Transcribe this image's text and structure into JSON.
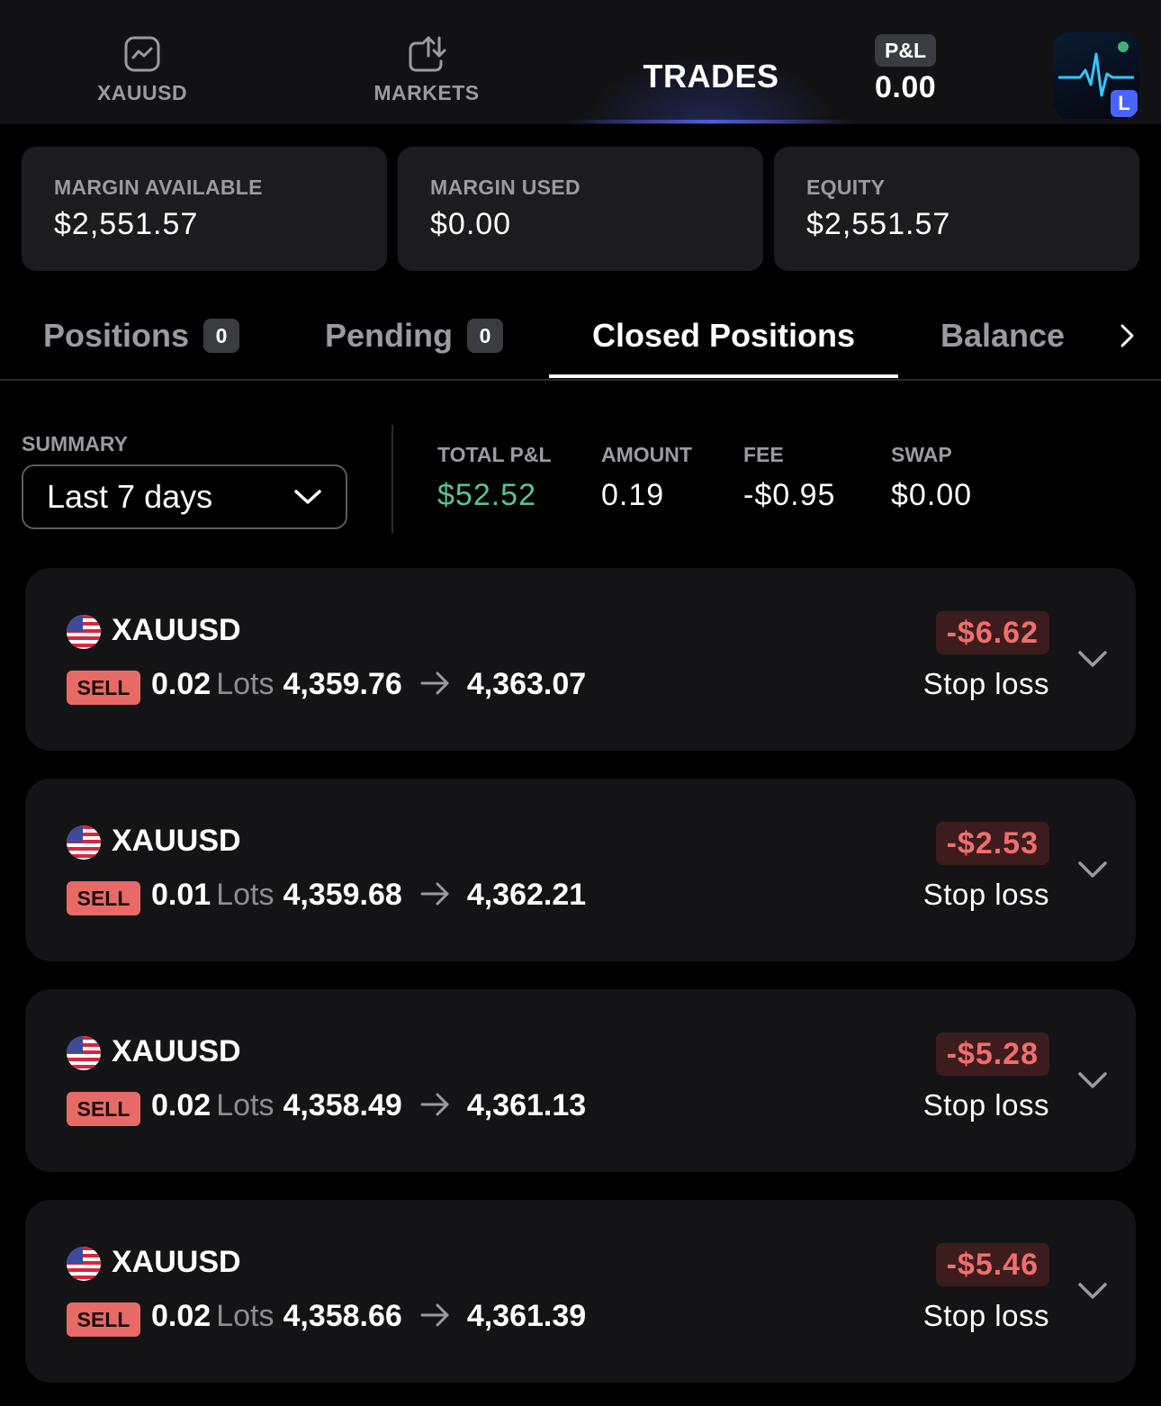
{
  "nav": {
    "xauusd_label": "XAUUSD",
    "markets_label": "MARKETS",
    "trades_label": "TRADES",
    "pnl_badge": "P&L",
    "pnl_value": "0.00",
    "logo_badge": "L"
  },
  "stats": {
    "margin_available": {
      "label": "MARGIN AVAILABLE",
      "value": "$2,551.57"
    },
    "margin_used": {
      "label": "MARGIN USED",
      "value": "$0.00"
    },
    "equity": {
      "label": "EQUITY",
      "value": "$2,551.57"
    }
  },
  "tabs": {
    "positions": {
      "label": "Positions",
      "count": "0"
    },
    "pending": {
      "label": "Pending",
      "count": "0"
    },
    "closed": {
      "label": "Closed Positions"
    },
    "balance": {
      "label": "Balance"
    }
  },
  "summary": {
    "label": "SUMMARY",
    "period": "Last 7 days",
    "total_pnl": {
      "label": "TOTAL P&L",
      "value": "$52.52"
    },
    "amount": {
      "label": "AMOUNT",
      "value": "0.19"
    },
    "fee": {
      "label": "FEE",
      "value": "-$0.95"
    },
    "swap": {
      "label": "SWAP",
      "value": "$0.00"
    }
  },
  "trades": [
    {
      "symbol": "XAUUSD",
      "side": "SELL",
      "lots": "0.02",
      "lots_unit": "Lots",
      "open": "4,359.76",
      "close": "4,363.07",
      "pnl": "-$6.62",
      "reason": "Stop loss"
    },
    {
      "symbol": "XAUUSD",
      "side": "SELL",
      "lots": "0.01",
      "lots_unit": "Lots",
      "open": "4,359.68",
      "close": "4,362.21",
      "pnl": "-$2.53",
      "reason": "Stop loss"
    },
    {
      "symbol": "XAUUSD",
      "side": "SELL",
      "lots": "0.02",
      "lots_unit": "Lots",
      "open": "4,358.49",
      "close": "4,361.13",
      "pnl": "-$5.28",
      "reason": "Stop loss"
    },
    {
      "symbol": "XAUUSD",
      "side": "SELL",
      "lots": "0.02",
      "lots_unit": "Lots",
      "open": "4,358.66",
      "close": "4,361.39",
      "pnl": "-$5.46",
      "reason": "Stop loss"
    }
  ],
  "colors": {
    "background": "#000000",
    "card": "#1c1c20",
    "positive": "#5cc48d",
    "negative": "#ef6f6d",
    "sell_badge": "#e86a67",
    "accent": "#4a5fe0"
  },
  "icons": [
    "chart-square-icon",
    "swap-arrows-icon",
    "chevron-right-icon",
    "chevron-down-icon",
    "us-flag-icon",
    "arrow-right-icon",
    "heartbeat-logo-icon"
  ]
}
